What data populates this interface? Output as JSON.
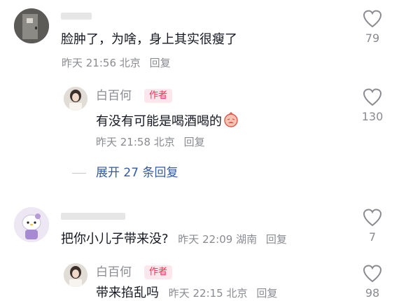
{
  "comments": [
    {
      "text": "脸肿了，为啥，身上其实很瘦了",
      "time": "昨天 21:56",
      "location": "北京",
      "reply_label": "回复",
      "likes": "79"
    },
    {
      "author": "白百何",
      "badge": "作者",
      "text": "有没有可能是喝酒喝的",
      "time": "昨天 21:58",
      "location": "北京",
      "reply_label": "回复",
      "likes": "130"
    },
    {
      "expand_label": "展开 27 条回复"
    },
    {
      "text": "把你小儿子带来没?",
      "time": "昨天 22:09",
      "location": "湖南",
      "reply_label": "回复",
      "likes": "7"
    },
    {
      "author": "白百何",
      "badge": "作者",
      "text": "带来掐乱吗",
      "time": "昨天 22:15",
      "location": "北京",
      "reply_label": "回复",
      "likes": "98"
    }
  ],
  "colors": {
    "accent": "#fe2c55",
    "link": "#2f5aa8",
    "meta": "#8a8b91",
    "text": "#161823"
  }
}
